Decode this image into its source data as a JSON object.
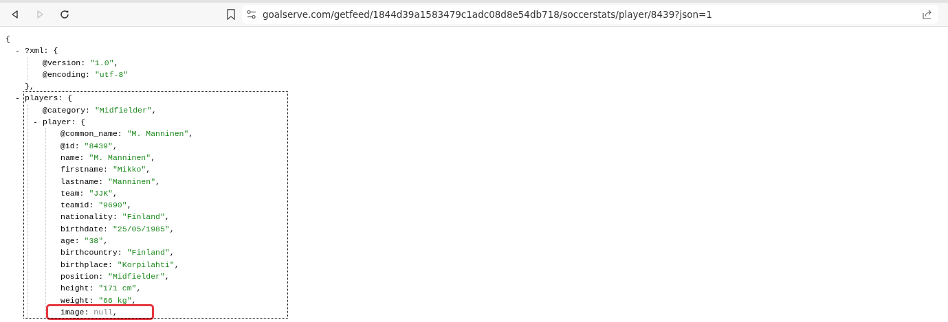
{
  "browser": {
    "nav_buttons": [
      {
        "kind": "back",
        "disabled": false
      },
      {
        "kind": "forward",
        "disabled": true
      },
      {
        "kind": "reload",
        "disabled": false
      }
    ],
    "url": "goalserve.com/getfeed/1844d39a1583479c1adc08d8e54db718/soccerstats/player/8439?json=1"
  },
  "document": {
    "open": "{",
    "children": [
      {
        "kind": "object",
        "toggle": "-",
        "key": "?xml:",
        "open": "{",
        "close": "}",
        "comma": ",",
        "focused": false,
        "children": [
          {
            "kind": "string",
            "key": "@version:",
            "value": "\"1.0\"",
            "comma": ","
          },
          {
            "kind": "string",
            "key": "@encoding:",
            "value": "\"utf-8\""
          }
        ]
      },
      {
        "kind": "object",
        "toggle": "-",
        "key": "players:",
        "open": "{",
        "focused": true,
        "children": [
          {
            "kind": "string",
            "key": "@category:",
            "value": "\"Midfielder\"",
            "comma": ","
          },
          {
            "kind": "object",
            "toggle": "-",
            "key": "player:",
            "open": "{",
            "focused": false,
            "children": [
              {
                "kind": "string",
                "key": "@common_name:",
                "value": "\"M. Manninen\"",
                "comma": ","
              },
              {
                "kind": "string",
                "key": "@id:",
                "value": "\"8439\"",
                "comma": ","
              },
              {
                "kind": "string",
                "key": "name:",
                "value": "\"M. Manninen\"",
                "comma": ","
              },
              {
                "kind": "string",
                "key": "firstname:",
                "value": "\"Mikko\"",
                "comma": ","
              },
              {
                "kind": "string",
                "key": "lastname:",
                "value": "\"Manninen\"",
                "comma": ","
              },
              {
                "kind": "string",
                "key": "team:",
                "value": "\"JJK\"",
                "comma": ","
              },
              {
                "kind": "string",
                "key": "teamid:",
                "value": "\"9690\"",
                "comma": ","
              },
              {
                "kind": "string",
                "key": "nationality:",
                "value": "\"Finland\"",
                "comma": ","
              },
              {
                "kind": "string",
                "key": "birthdate:",
                "value": "\"25/05/1985\"",
                "comma": ","
              },
              {
                "kind": "string",
                "key": "age:",
                "value": "\"38\"",
                "comma": ","
              },
              {
                "kind": "string",
                "key": "birthcountry:",
                "value": "\"Finland\"",
                "comma": ","
              },
              {
                "kind": "string",
                "key": "birthplace:",
                "value": "\"Korpilahti\"",
                "comma": ","
              },
              {
                "kind": "string",
                "key": "position:",
                "value": "\"Midfielder\"",
                "comma": ","
              },
              {
                "kind": "string",
                "key": "height:",
                "value": "\"171 cm\"",
                "comma": ","
              },
              {
                "kind": "string",
                "key": "weight:",
                "value": "\"66 kg\"",
                "comma": ","
              },
              {
                "kind": "null",
                "key": "image:",
                "value": "null",
                "comma": ",",
                "highlighted": true
              }
            ]
          }
        ]
      }
    ]
  }
}
